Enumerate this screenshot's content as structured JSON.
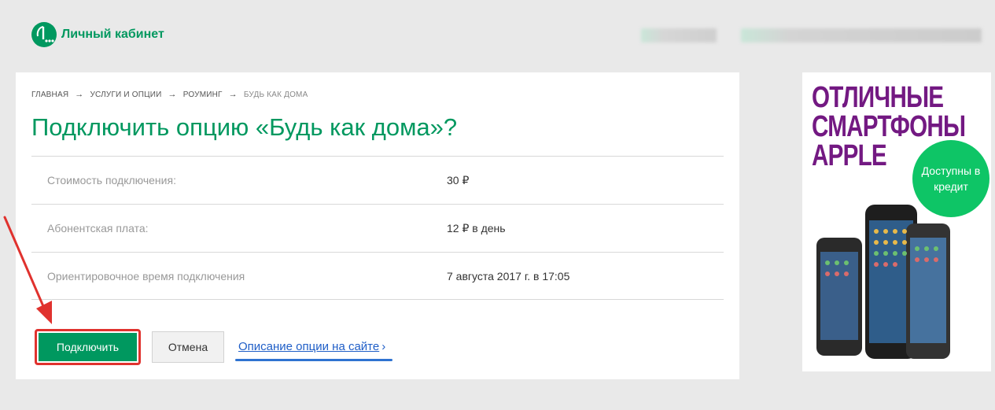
{
  "header": {
    "logo_label": "Личный кабинет"
  },
  "breadcrumb": [
    {
      "label": "Главная"
    },
    {
      "label": "Услуги и опции"
    },
    {
      "label": "Роуминг"
    },
    {
      "label": "Будь как дома"
    }
  ],
  "breadcrumb_sep": "→",
  "page": {
    "title": "Подключить опцию «Будь как дома»?"
  },
  "details": [
    {
      "label": "Стоимость подключения:",
      "value": "30 ₽"
    },
    {
      "label": "Абонентская плата:",
      "value": "12 ₽ в день"
    },
    {
      "label": "Ориентировочное время подключения",
      "value": "7 августа 2017 г. в 17:05"
    }
  ],
  "actions": {
    "connect_label": "Подключить",
    "cancel_label": "Отмена",
    "description_link": "Описание опции на сайте",
    "description_arrow": "›"
  },
  "ad": {
    "headline": [
      "Отличные",
      "смартфоны",
      "Apple"
    ],
    "badge": "Доступны в кредит"
  },
  "colors": {
    "brand_green": "#00985f",
    "ad_purple": "#731982",
    "ad_green": "#0ec566",
    "annotation_red": "#e0322e",
    "link_blue": "#1f5ec7"
  }
}
